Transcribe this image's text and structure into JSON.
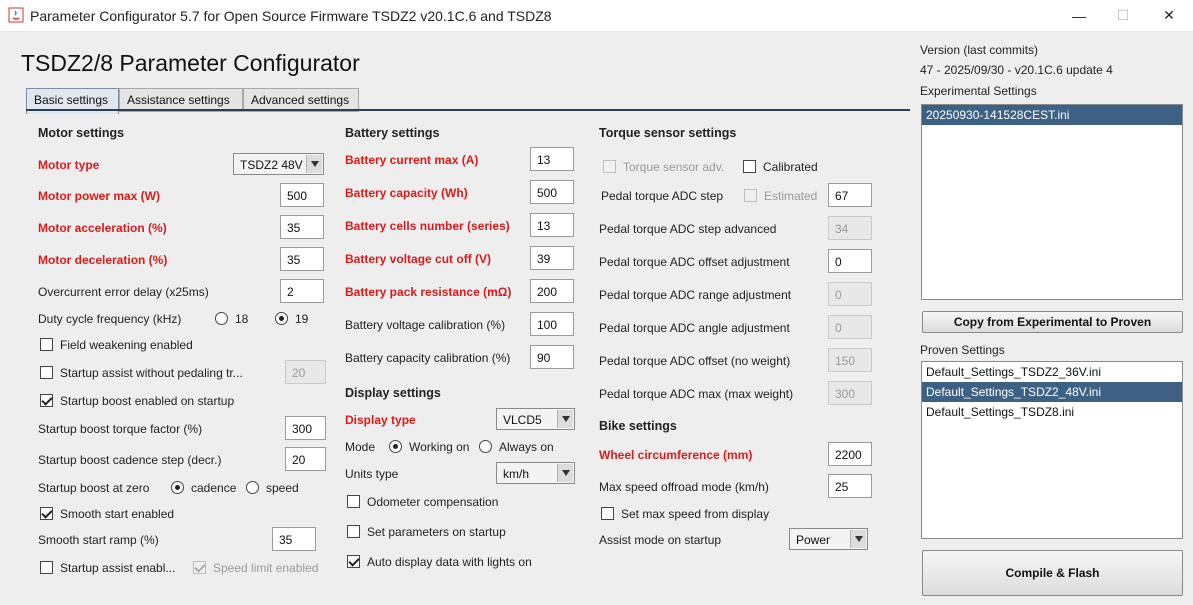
{
  "window": {
    "title": "Parameter Configurator 5.7 for Open Source Firmware TSDZ2 v20.1C.6 and TSDZ8",
    "minimize": "—",
    "maximize": "☐",
    "close": "✕"
  },
  "app_title": "TSDZ2/8 Parameter Configurator",
  "tabs": [
    "Basic settings",
    "Assistance settings",
    "Advanced settings"
  ],
  "motor": {
    "title": "Motor settings",
    "type_label": "Motor type",
    "type_value": "TSDZ2 48V",
    "power_label": "Motor power max (W)",
    "power_value": "500",
    "accel_label": "Motor acceleration (%)",
    "accel_value": "35",
    "decel_label": "Motor deceleration (%)",
    "decel_value": "35",
    "overcurrent_label": "Overcurrent error delay (x25ms)",
    "overcurrent_value": "2",
    "duty_label": "Duty cycle frequency (kHz)",
    "duty_opt1": "18",
    "duty_opt2": "19",
    "field_weak_label": "Field weakening enabled",
    "startup_assist_label": "Startup assist without pedaling tr...",
    "startup_assist_value": "20",
    "startup_boost_label": "Startup boost enabled  on startup",
    "boost_torque_label": "Startup boost torque factor (%)",
    "boost_torque_value": "300",
    "boost_cadence_label": "Startup boost cadence step (decr.)",
    "boost_cadence_value": "20",
    "boost_zero_label": "Startup boost at zero",
    "boost_zero_opt1": "cadence",
    "boost_zero_opt2": "speed",
    "smooth_label": "Smooth start enabled",
    "smooth_ramp_label": "Smooth start ramp (%)",
    "smooth_ramp_value": "35",
    "startup_assist_en_label": "Startup assist enabl...",
    "speed_limit_label": "Speed limit enabled"
  },
  "battery": {
    "title": "Battery settings",
    "current_label": "Battery current max (A)",
    "current_value": "13",
    "capacity_label": "Battery capacity (Wh)",
    "capacity_value": "500",
    "cells_label": "Battery cells number (series)",
    "cells_value": "13",
    "cutoff_label": "Battery voltage cut off (V)",
    "cutoff_value": "39",
    "resistance_label": "Battery pack resistance (mΩ)",
    "resistance_value": "200",
    "volt_cal_label": "Battery voltage calibration (%)",
    "volt_cal_value": "100",
    "cap_cal_label": "Battery capacity calibration (%)",
    "cap_cal_value": "90"
  },
  "display": {
    "title": "Display settings",
    "type_label": "Display type",
    "type_value": "VLCD5",
    "mode_label": "Mode",
    "mode_opt1": "Working on",
    "mode_opt2": "Always on",
    "units_label": "Units type",
    "units_value": "km/h",
    "odometer_label": "Odometer compensation",
    "set_params_label": "Set parameters on startup",
    "auto_display_label": "Auto display data with lights on"
  },
  "torque": {
    "title": "Torque sensor settings",
    "adv_label": "Torque sensor adv.",
    "calibrated_label": "Calibrated",
    "step_label": "Pedal torque ADC step",
    "estimated_label": "Estimated",
    "step_value": "67",
    "step_adv_label": "Pedal torque ADC step advanced",
    "step_adv_value": "34",
    "offset_adj_label": "Pedal torque ADC offset adjustment",
    "offset_adj_value": "0",
    "range_adj_label": "Pedal torque ADC range adjustment",
    "range_adj_value": "0",
    "angle_adj_label": "Pedal torque ADC angle adjustment",
    "angle_adj_value": "0",
    "offset_label": "Pedal torque ADC offset (no weight)",
    "offset_value": "150",
    "max_label": "Pedal torque ADC max (max weight)",
    "max_value": "300"
  },
  "bike": {
    "title": "Bike settings",
    "wheel_label": "Wheel circumference (mm)",
    "wheel_value": "2200",
    "max_speed_label": "Max speed offroad mode (km/h)",
    "max_speed_value": "25",
    "set_max_label": "Set max speed from display",
    "assist_mode_label": "Assist mode on startup",
    "assist_mode_value": "Power"
  },
  "right": {
    "version_label": "Version (last commits)",
    "version_value": "47 - 2025/09/30 - v20.1C.6 update 4",
    "experimental_label": "Experimental Settings",
    "experimental_items": [
      "20250930-141528CEST.ini"
    ],
    "copy_button": "Copy from Experimental to Proven",
    "proven_label": "Proven Settings",
    "proven_items": [
      "Default_Settings_TSDZ2_36V.ini",
      "Default_Settings_TSDZ2_48V.ini",
      "Default_Settings_TSDZ8.ini"
    ],
    "compile_button": "Compile & Flash"
  },
  "colors": {
    "required_label": "#dd1a1a",
    "selection": "#3d6185",
    "tab_underline": "#2c3e50"
  }
}
